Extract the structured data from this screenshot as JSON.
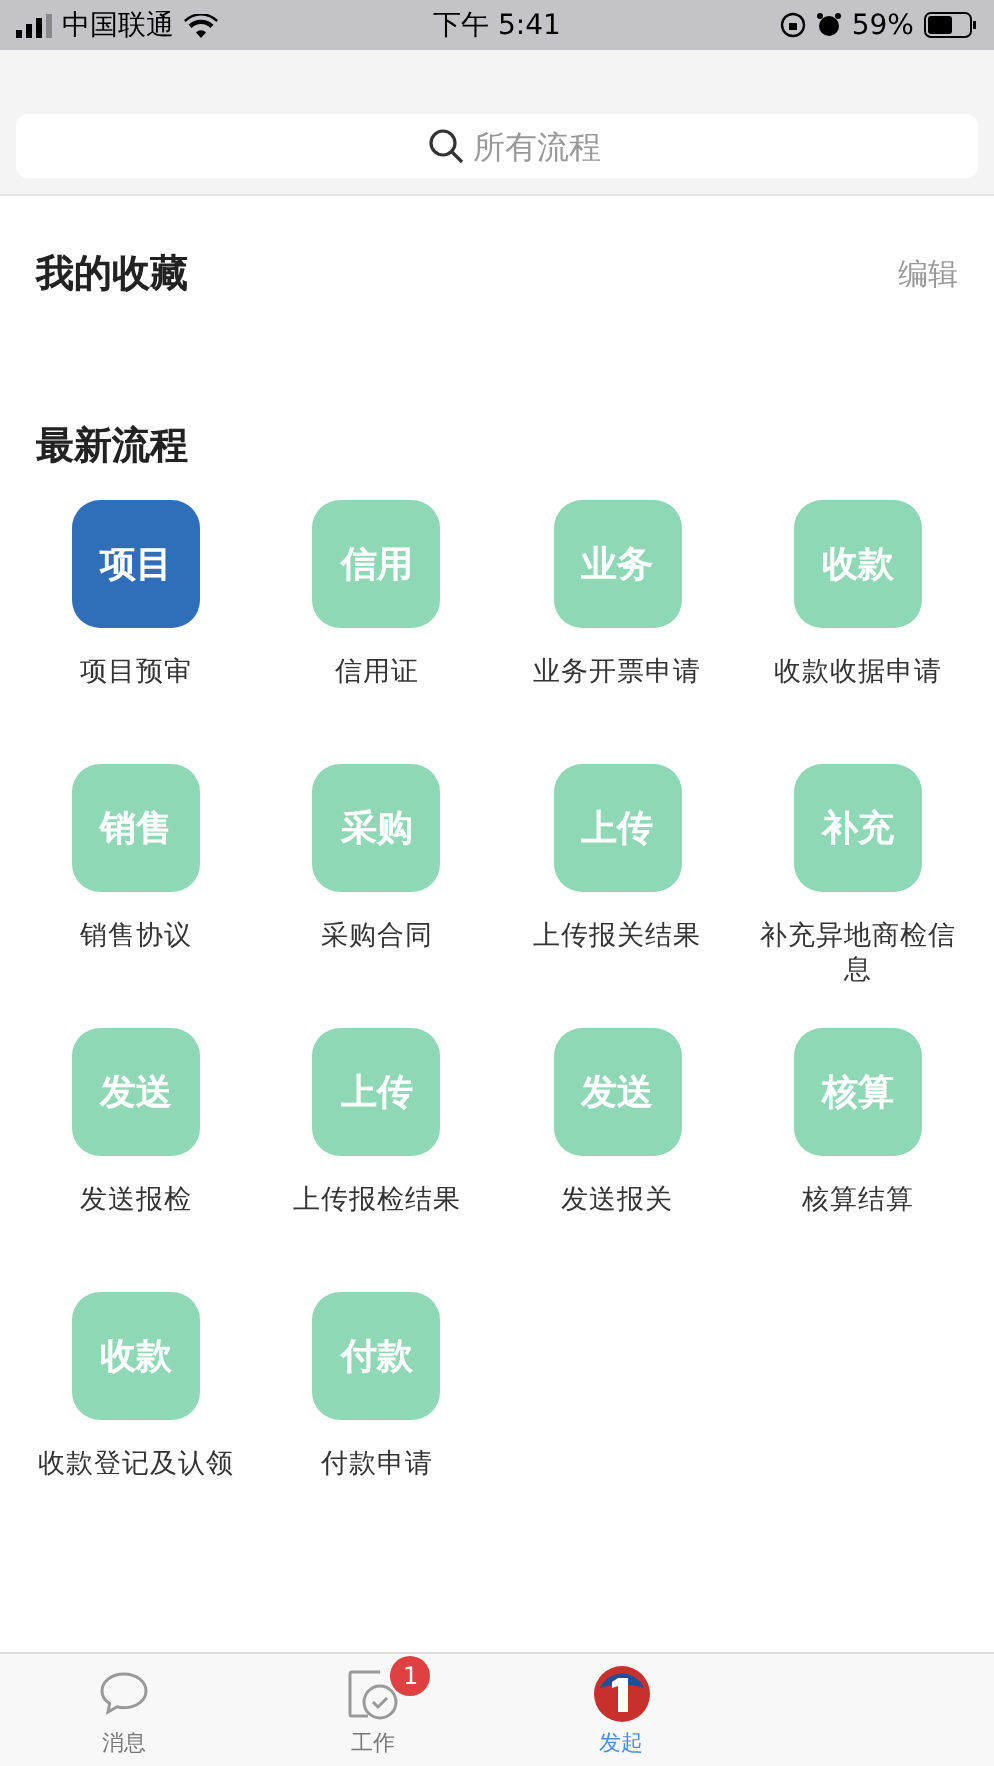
{
  "status_bar": {
    "carrier": "中国联通",
    "time": "下午 5:41",
    "battery": "59%"
  },
  "search": {
    "placeholder": "所有流程"
  },
  "favorites": {
    "title": "我的收藏",
    "action": "编辑"
  },
  "recent": {
    "title": "最新流程",
    "items": [
      {
        "icon_text": "项目",
        "label": "项目预审",
        "color": "#2f6fba"
      },
      {
        "icon_text": "信用",
        "label": "信用证",
        "color": "#8fd8b5"
      },
      {
        "icon_text": "业务",
        "label": "业务开票申请",
        "color": "#8fd8b5"
      },
      {
        "icon_text": "收款",
        "label": "收款收据申请",
        "color": "#8fd8b5"
      },
      {
        "icon_text": "销售",
        "label": "销售协议",
        "color": "#8fd8b5"
      },
      {
        "icon_text": "采购",
        "label": "采购合同",
        "color": "#8fd8b5"
      },
      {
        "icon_text": "上传",
        "label": "上传报关结果",
        "color": "#8fd8b5"
      },
      {
        "icon_text": "补充",
        "label": "补充异地商检信息",
        "color": "#8fd8b5"
      },
      {
        "icon_text": "发送",
        "label": "发送报检",
        "color": "#8fd8b5"
      },
      {
        "icon_text": "上传",
        "label": "上传报检结果",
        "color": "#8fd8b5"
      },
      {
        "icon_text": "发送",
        "label": "发送报关",
        "color": "#8fd8b5"
      },
      {
        "icon_text": "核算",
        "label": "核算结算",
        "color": "#8fd8b5"
      },
      {
        "icon_text": "收款",
        "label": "收款登记及认领",
        "color": "#8fd8b5"
      },
      {
        "icon_text": "付款",
        "label": "付款申请",
        "color": "#8fd8b5"
      }
    ]
  },
  "tab_bar": [
    {
      "kind": "message",
      "label": "消息",
      "selected": false
    },
    {
      "kind": "work",
      "label": "工作",
      "selected": false,
      "badge": "1"
    },
    {
      "kind": "launch",
      "label": "发起",
      "selected": true
    }
  ]
}
